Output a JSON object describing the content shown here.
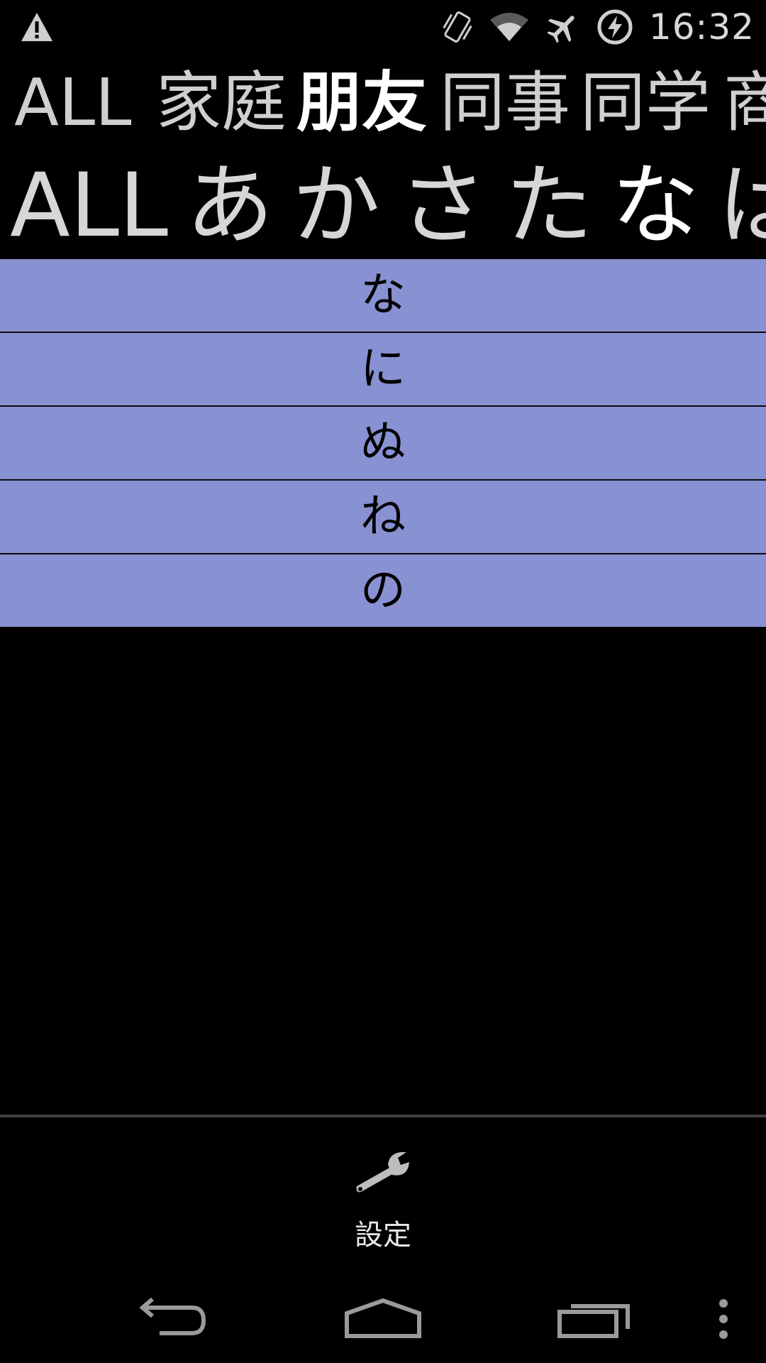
{
  "status_bar": {
    "time": "16:32",
    "icons": [
      "warning-icon",
      "vibrate-icon",
      "wifi-icon",
      "airplane-icon",
      "battery-charging-icon"
    ]
  },
  "categories": {
    "items": [
      {
        "label": "ALL",
        "active": false
      },
      {
        "label": "家庭",
        "active": false
      },
      {
        "label": "朋友",
        "active": true
      },
      {
        "label": "同事",
        "active": false
      },
      {
        "label": "同学",
        "active": false
      },
      {
        "label": "商",
        "active": false
      }
    ]
  },
  "kana_index": {
    "items": [
      {
        "label": "ALL",
        "active": false
      },
      {
        "label": "あ",
        "active": false
      },
      {
        "label": "か",
        "active": false
      },
      {
        "label": "さ",
        "active": false
      },
      {
        "label": "た",
        "active": false
      },
      {
        "label": "な",
        "active": true
      },
      {
        "label": "は",
        "active": false
      }
    ]
  },
  "list": {
    "items": [
      "な",
      "に",
      "ぬ",
      "ね",
      "の"
    ]
  },
  "bottom_menu": {
    "settings_label": "設定",
    "settings_icon": "wrench-icon"
  },
  "nav_bar": {
    "icons": [
      "back-icon",
      "home-icon",
      "recent-apps-icon",
      "overflow-menu-icon"
    ]
  }
}
